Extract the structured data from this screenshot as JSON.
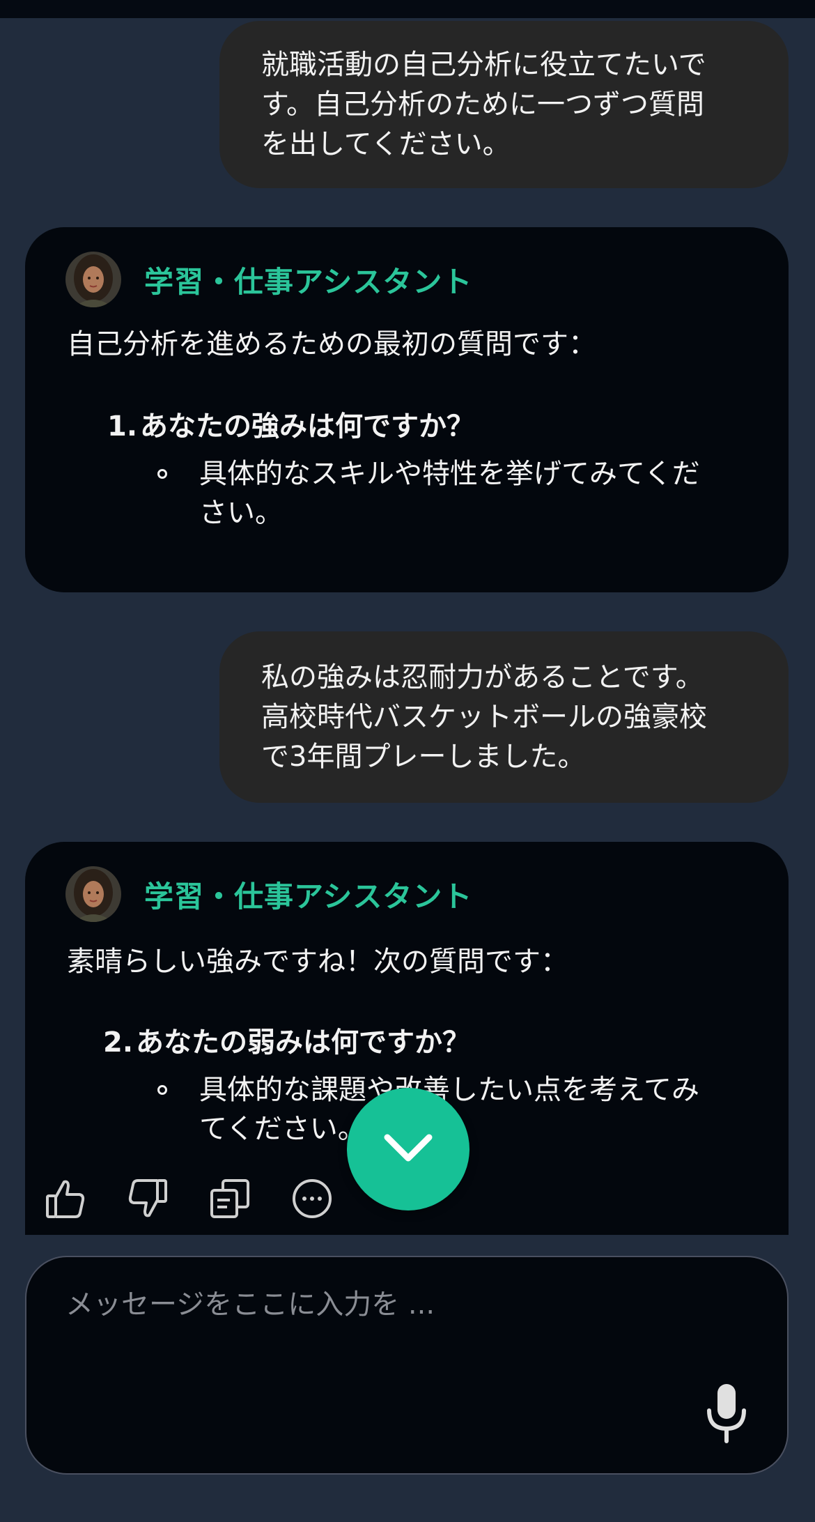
{
  "messages": [
    {
      "role": "user",
      "lines": [
        "就職活動の自己分析に役立てたいで",
        "す。自己分析のために一つずつ質問",
        "を出してください。"
      ]
    },
    {
      "role": "assistant",
      "name": "学習・仕事アシスタント",
      "intro": "自己分析を進めるための最初の質問です：",
      "question_num": "1.",
      "question": "あなたの強みは何ですか？",
      "sub_lines": [
        "具体的なスキルや特性を挙げてみてくだ",
        "さい。"
      ]
    },
    {
      "role": "user",
      "lines": [
        "私の強みは忍耐力があることです。",
        "高校時代バスケットボールの強豪校",
        "で3年間プレーしました。"
      ]
    },
    {
      "role": "assistant",
      "name": "学習・仕事アシスタント",
      "intro": "素晴らしい強みですね！次の質問です：",
      "question_num": "2.",
      "question": "あなたの弱みは何ですか？",
      "sub_lines": [
        "具体的な課題や改善したい点を考えてみ",
        "てください。"
      ]
    }
  ],
  "actions": [
    "thumbs-up-icon",
    "thumbs-down-icon",
    "copy-icon",
    "more-icon"
  ],
  "composer": {
    "placeholder": "メッセージをここに入力を ..."
  },
  "colors": {
    "background": "#212c3d",
    "accent": "#16c196",
    "bot_name": "#2bc59a",
    "user_bubble": "#262626",
    "bot_bubble": "#03070d"
  }
}
